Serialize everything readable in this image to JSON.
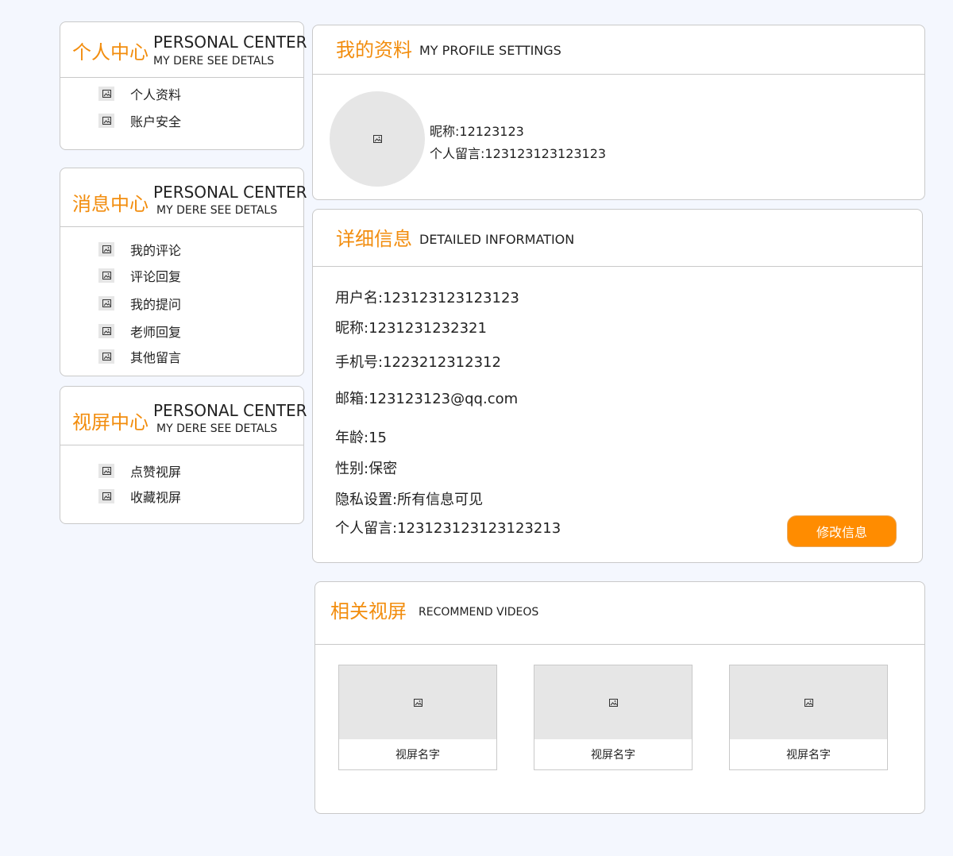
{
  "sidebar": {
    "personal": {
      "title_cn": "个人中心",
      "title_en": "PERSONAL CENTER",
      "subtitle_en": "MY DERE SEE DETALS",
      "items": [
        {
          "label": "个人资料",
          "icon": "image-icon"
        },
        {
          "label": "账户安全",
          "icon": "image-icon"
        }
      ]
    },
    "message": {
      "title_cn": "消息中心",
      "title_en": "PERSONAL CENTER",
      "subtitle_en": "MY DERE SEE DETALS",
      "items": [
        {
          "label": "我的评论",
          "icon": "image-icon"
        },
        {
          "label": "评论回复",
          "icon": "image-icon"
        },
        {
          "label": "我的提问",
          "icon": "image-icon"
        },
        {
          "label": "老师回复",
          "icon": "image-icon"
        },
        {
          "label": "其他留言",
          "icon": "image-icon"
        }
      ]
    },
    "video": {
      "title_cn": "视屏中心",
      "title_en": "PERSONAL CENTER",
      "subtitle_en": "MY DERE SEE DETALS",
      "items": [
        {
          "label": "点赞视屏",
          "icon": "image-icon"
        },
        {
          "label": "收藏视屏",
          "icon": "image-icon"
        }
      ]
    }
  },
  "profile": {
    "title_cn": "我的资料",
    "title_en": "MY PROFILE SETTINGS",
    "nickname": "昵称:12123123",
    "message": "个人留言:123123123123123"
  },
  "details": {
    "title_cn": "详细信息",
    "title_en": "DETAILED INFORMATION",
    "username": "用户名:123123123123123",
    "nickname": "昵称:1231231232321",
    "phone": "手机号:1223212312312",
    "email": "邮箱:123123123@qq.com",
    "age": "年龄:15",
    "gender": "性别:保密",
    "privacy": "隐私设置:所有信息可见",
    "message": "个人留言:123123123123123213",
    "edit_button": "修改信息"
  },
  "recommend": {
    "title_cn": "相关视屏",
    "title_en": "RECOMMEND VIDEOS",
    "videos": [
      {
        "name": "视屏名字"
      },
      {
        "name": "视屏名字"
      },
      {
        "name": "视屏名字"
      }
    ]
  },
  "colors": {
    "accent": "#f28d0e",
    "button": "#ff8c00",
    "background": "#f4f7fe",
    "placeholder": "#e6e6e6"
  }
}
